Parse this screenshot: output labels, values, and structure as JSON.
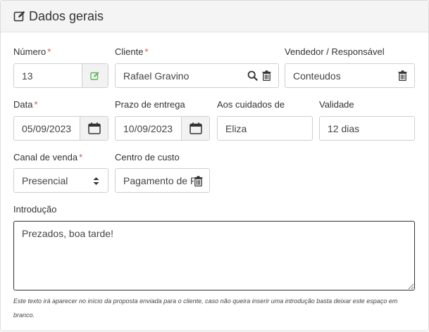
{
  "header": {
    "title": "Dados gerais",
    "icon": "edit-icon"
  },
  "numero": {
    "label": "Número",
    "required_mark": "*",
    "value": "13",
    "icon": "edit-icon"
  },
  "cliente": {
    "label": "Cliente",
    "required_mark": "*",
    "value": "Rafael Gravino",
    "icons": [
      "search-icon",
      "trash-icon"
    ]
  },
  "vendedor": {
    "label": "Vendedor / Responsável",
    "value": "Conteudos",
    "icon": "trash-icon"
  },
  "data": {
    "label": "Data",
    "required_mark": "*",
    "value": "05/09/2023",
    "icon": "calendar-icon"
  },
  "prazo": {
    "label": "Prazo de entrega",
    "value": "10/09/2023",
    "icon": "calendar-icon"
  },
  "cuidados": {
    "label": "Aos cuidados de",
    "value": "Eliza"
  },
  "validade": {
    "label": "Validade",
    "value": "12 dias"
  },
  "canal": {
    "label": "Canal de venda",
    "required_mark": "*",
    "value": "Presencial",
    "icon": "sort-caret-icon"
  },
  "centro": {
    "label": "Centro de custo",
    "value": "Pagamento de Fé",
    "icon": "trash-icon"
  },
  "introducao": {
    "label": "Introdução",
    "value": "Prezados, boa tarde!",
    "help": "Este texto irá aparecer no início da proposta enviada para o cliente, caso não queira inserir uma introdução basta deixar este espaço em branco."
  },
  "colors": {
    "accent_green": "#5cb85c",
    "required_red": "#d9534f",
    "header_bg": "#f4f4f4"
  }
}
